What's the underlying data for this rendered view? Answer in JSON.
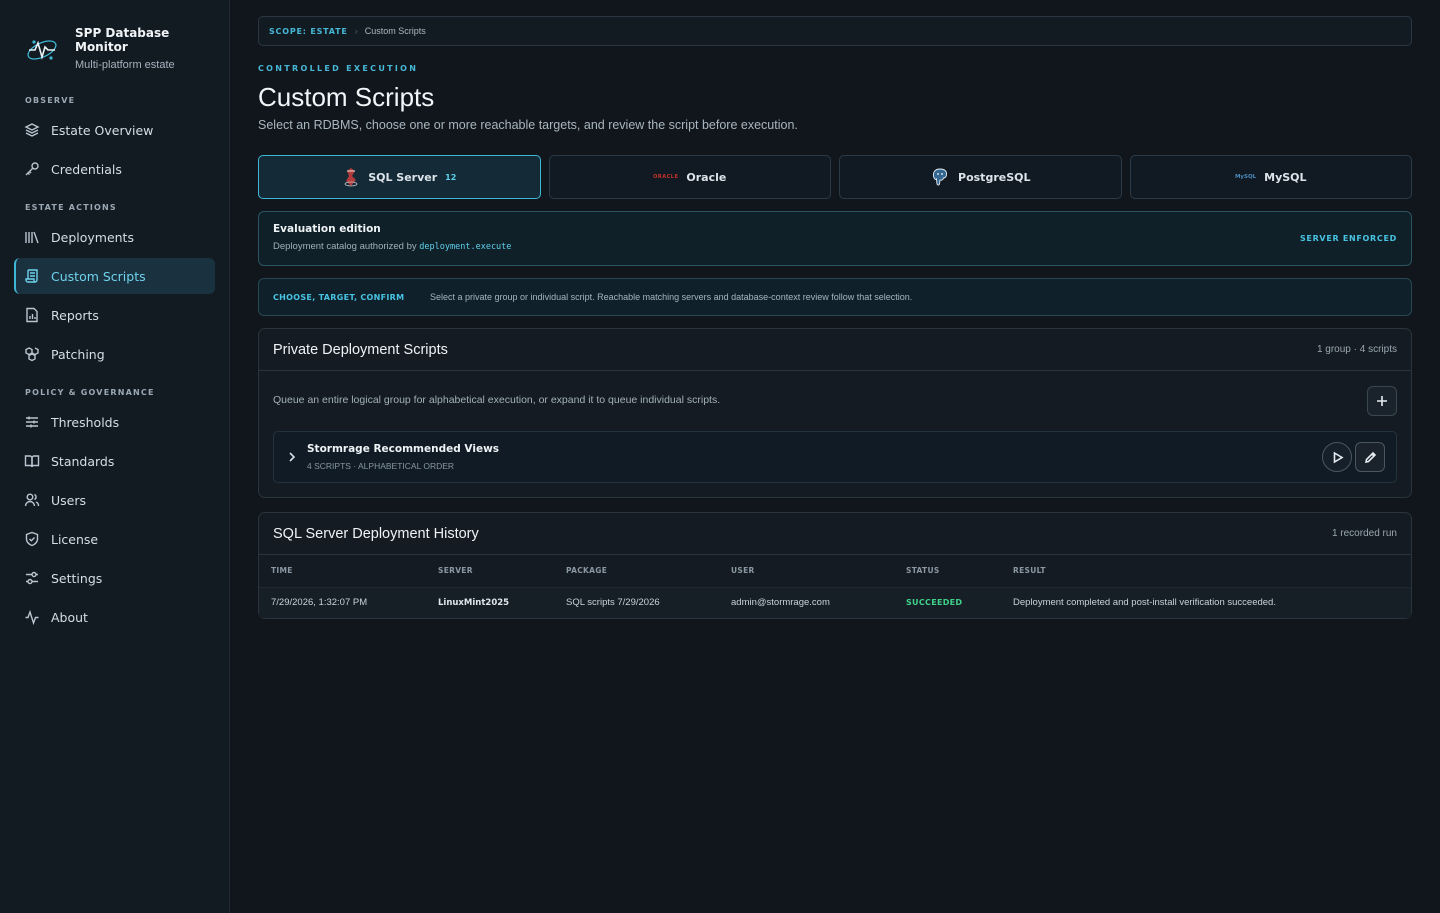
{
  "brand": {
    "title": "SPP Database Monitor",
    "subtitle": "Multi-platform estate"
  },
  "sidebar": {
    "sections": [
      "OBSERVE",
      "ESTATE ACTIONS",
      "POLICY & GOVERNANCE"
    ],
    "items": [
      {
        "label": "Estate Overview",
        "icon": "layers-icon"
      },
      {
        "label": "Credentials",
        "icon": "key-icon"
      },
      {
        "label": "Deployments",
        "icon": "library-icon"
      },
      {
        "label": "Custom Scripts",
        "icon": "scroll-icon",
        "active": true
      },
      {
        "label": "Reports",
        "icon": "report-icon"
      },
      {
        "label": "Patching",
        "icon": "boxes-icon"
      },
      {
        "label": "Thresholds",
        "icon": "sliders-icon"
      },
      {
        "label": "Standards",
        "icon": "book-icon"
      },
      {
        "label": "Users",
        "icon": "users-icon"
      },
      {
        "label": "License",
        "icon": "shield-icon"
      },
      {
        "label": "Settings",
        "icon": "settings-icon"
      },
      {
        "label": "About",
        "icon": "activity-icon"
      }
    ]
  },
  "breadcrumb": {
    "scope": "SCOPE: ESTATE",
    "separator": "›",
    "page": "Custom Scripts"
  },
  "header": {
    "eyebrow": "CONTROLLED EXECUTION",
    "title": "Custom Scripts",
    "subtitle": "Select an RDBMS, choose one or more reachable targets, and review the script before execution."
  },
  "rdbms_tabs": [
    {
      "label": "SQL Server",
      "count": "12",
      "active": true
    },
    {
      "label": "Oracle",
      "logo_text": "ORACLE"
    },
    {
      "label": "PostgreSQL"
    },
    {
      "label": "MySQL",
      "logo_text": "MySQL"
    }
  ],
  "evaluation": {
    "title": "Evaluation edition",
    "desc_prefix": "Deployment catalog authorized by",
    "permission": "deployment.execute",
    "badge": "SERVER ENFORCED"
  },
  "steps": {
    "label": "CHOOSE, TARGET, CONFIRM",
    "text": "Select a private group or individual script. Reachable matching servers and database-context review follow that selection."
  },
  "scripts": {
    "title": "Private Deployment Scripts",
    "meta": "1 group · 4 scripts",
    "desc": "Queue an entire logical group for alphabetical execution, or expand it to queue individual scripts.",
    "group": {
      "name": "Stormrage Recommended Views",
      "sub": "4 SCRIPTS · ALPHABETICAL ORDER"
    }
  },
  "history": {
    "title": "SQL Server Deployment History",
    "meta": "1 recorded run",
    "columns": [
      "TIME",
      "SERVER",
      "PACKAGE",
      "USER",
      "STATUS",
      "RESULT"
    ],
    "rows": [
      {
        "time": "7/29/2026, 1:32:07 PM",
        "server": "LinuxMint2025",
        "package": "SQL scripts 7/29/2026",
        "user": "admin@stormrage.com",
        "status": "SUCCEEDED",
        "result": "Deployment completed and post-install verification succeeded."
      }
    ]
  },
  "colors": {
    "accent": "#3fb8d6",
    "success": "#3ed38a",
    "background": "#10161c"
  }
}
